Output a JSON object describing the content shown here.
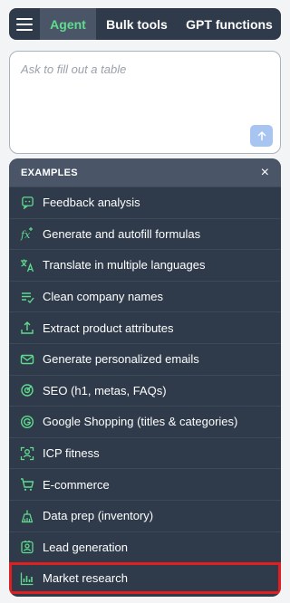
{
  "nav": {
    "tabs": [
      {
        "label": "Agent"
      },
      {
        "label": "Bulk tools"
      },
      {
        "label": "GPT functions"
      }
    ]
  },
  "input": {
    "placeholder": "Ask to fill out a table"
  },
  "examples": {
    "title": "EXAMPLES",
    "close": "×",
    "items": [
      {
        "label": "Feedback analysis",
        "icon": "feedback-icon"
      },
      {
        "label": "Generate and autofill formulas",
        "icon": "formula-icon"
      },
      {
        "label": "Translate in multiple languages",
        "icon": "translate-icon"
      },
      {
        "label": "Clean company names",
        "icon": "clean-list-icon"
      },
      {
        "label": "Extract product attributes",
        "icon": "extract-icon"
      },
      {
        "label": "Generate personalized emails",
        "icon": "email-icon"
      },
      {
        "label": "SEO (h1, metas, FAQs)",
        "icon": "seo-icon"
      },
      {
        "label": "Google Shopping (titles & categories)",
        "icon": "google-icon"
      },
      {
        "label": "ICP fitness",
        "icon": "icp-icon"
      },
      {
        "label": "E-commerce",
        "icon": "cart-icon"
      },
      {
        "label": "Data prep (inventory)",
        "icon": "inventory-icon"
      },
      {
        "label": "Lead generation",
        "icon": "lead-icon"
      },
      {
        "label": "Market research",
        "icon": "chart-icon"
      }
    ]
  },
  "colors": {
    "accent_green": "#5fdc8e",
    "panel_bg": "#2f3a4a",
    "header_bg": "#4a5668",
    "highlight": "#e02020",
    "send_button": "#a8c4f0"
  }
}
